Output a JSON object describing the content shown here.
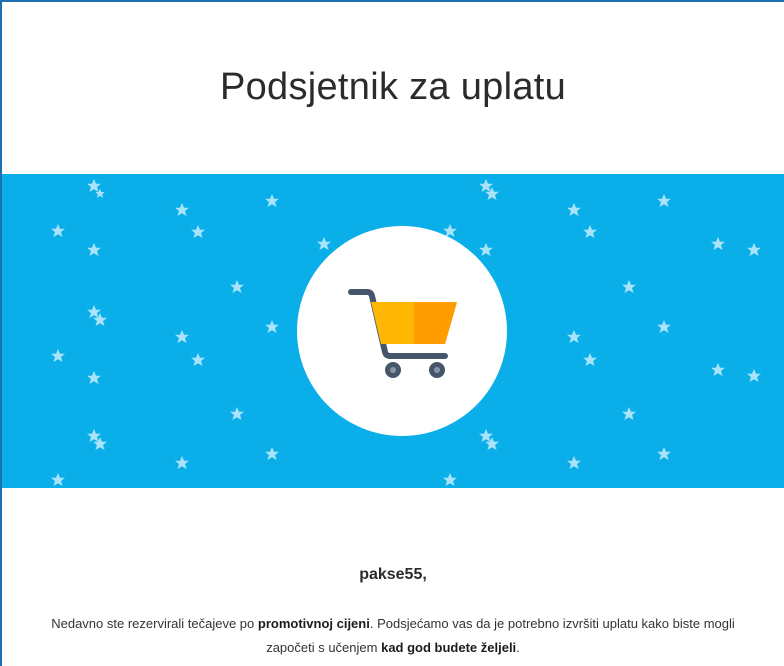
{
  "email": {
    "title": "Podsjetnik za uplatu",
    "banner_color": "#0aaee8",
    "icon": "shopping-cart-icon",
    "greeting": "pakse55,",
    "body": {
      "part1": "Nedavno ste rezervirali tečajeve po ",
      "bold1": "promotivnoj cijeni",
      "part2": ". Podsjećamo vas da je potrebno izvršiti uplatu kako biste mogli započeti s učenjem ",
      "bold2": "kad god budete željeli",
      "part3": "."
    }
  }
}
